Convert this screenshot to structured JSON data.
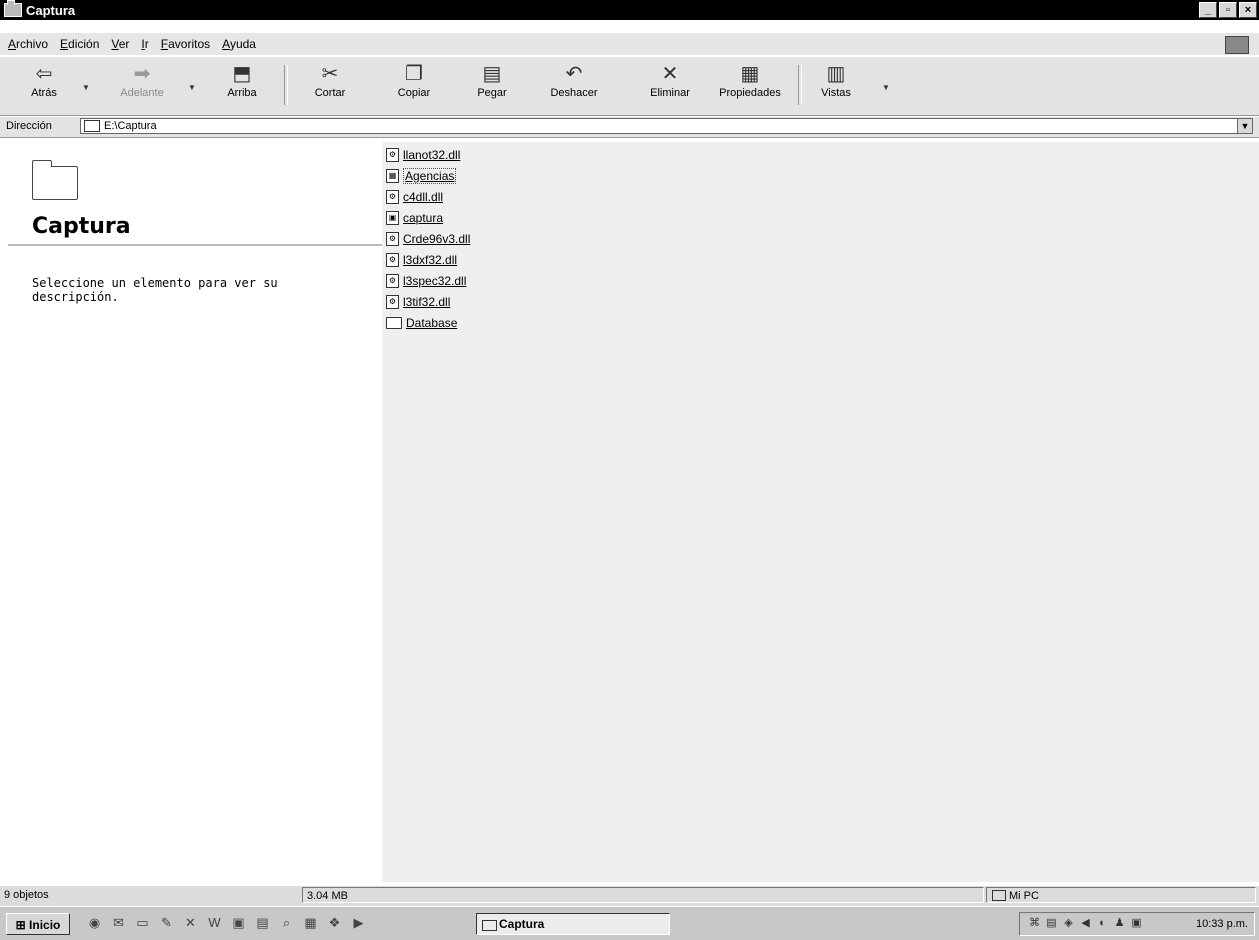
{
  "window": {
    "title": "Captura"
  },
  "menu": [
    "Archivo",
    "Edición",
    "Ver",
    "Ir",
    "Favoritos",
    "Ayuda"
  ],
  "toolbar": {
    "back": "Atrás",
    "forward": "Adelante",
    "up": "Arriba",
    "cut": "Cortar",
    "copy": "Copiar",
    "paste": "Pegar",
    "undo": "Deshacer",
    "delete": "Eliminar",
    "properties": "Propiedades",
    "views": "Vistas"
  },
  "address": {
    "label": "Dirección",
    "value": "E:\\Captura"
  },
  "left_pane": {
    "title": "Captura",
    "description": "Seleccione un elemento para ver su descripción."
  },
  "files": [
    {
      "name": "llanot32.dll",
      "icon": "dll-icon"
    },
    {
      "name": "Agencias",
      "icon": "database-file-icon"
    },
    {
      "name": "c4dll.dll",
      "icon": "dll-icon"
    },
    {
      "name": "captura",
      "icon": "executable-icon"
    },
    {
      "name": "Crde96v3.dll",
      "icon": "dll-icon"
    },
    {
      "name": "l3dxf32.dll",
      "icon": "dll-icon"
    },
    {
      "name": "l3spec32.dll",
      "icon": "dll-icon"
    },
    {
      "name": "l3tif32.dll",
      "icon": "dll-icon"
    },
    {
      "name": "Database",
      "icon": "folder-icon"
    }
  ],
  "status": {
    "objects": "9 objetos",
    "size": "3.04 MB",
    "location": "Mi PC"
  },
  "taskbar": {
    "start": "Inicio",
    "task": "Captura",
    "clock": "10:33 p.m."
  }
}
